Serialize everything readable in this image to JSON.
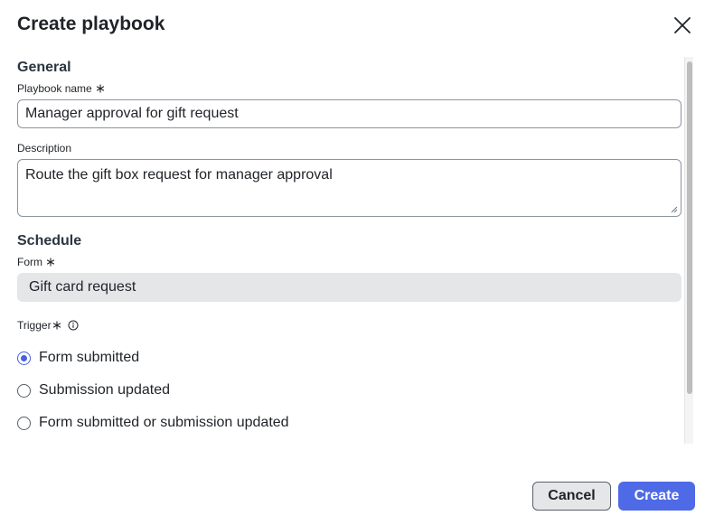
{
  "dialog": {
    "title": "Create playbook"
  },
  "general": {
    "heading": "General",
    "playbook_name_label": "Playbook name",
    "playbook_name_value": "Manager approval for gift request",
    "description_label": "Description",
    "description_value": "Route the gift box request for manager approval"
  },
  "schedule": {
    "heading": "Schedule",
    "form_label": "Form",
    "form_value": "Gift card request",
    "trigger_label": "Trigger",
    "trigger_options": [
      {
        "label": "Form submitted",
        "selected": true
      },
      {
        "label": "Submission updated",
        "selected": false
      },
      {
        "label": "Form submitted or submission updated",
        "selected": false
      }
    ]
  },
  "footer": {
    "cancel_label": "Cancel",
    "create_label": "Create"
  },
  "colors": {
    "accent": "#4f6ae6",
    "radio_selected": "#4a5fe0",
    "readonly_bg": "#e4e6e8"
  },
  "icons": {
    "close": "close-icon",
    "required": "asterisk-icon",
    "info": "info-icon"
  }
}
